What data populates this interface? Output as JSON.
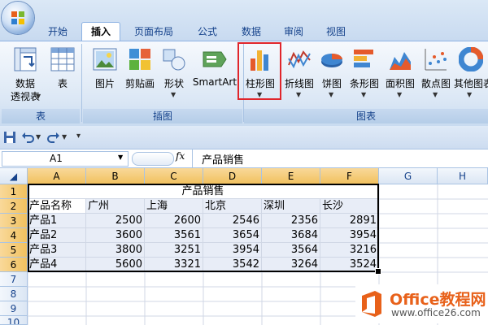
{
  "ribbon": {
    "tabs": [
      {
        "label": "开始"
      },
      {
        "label": "插入"
      },
      {
        "label": "页面布局"
      },
      {
        "label": "公式"
      },
      {
        "label": "数据"
      },
      {
        "label": "审阅"
      },
      {
        "label": "视图"
      }
    ],
    "active_tab": "插入",
    "groups": [
      {
        "label": "表",
        "buttons": [
          {
            "label": "数据透视表"
          },
          {
            "label": "表"
          }
        ]
      },
      {
        "label": "插图",
        "buttons": [
          {
            "label": "图片"
          },
          {
            "label": "剪贴画"
          },
          {
            "label": "形状"
          },
          {
            "label": "SmartArt"
          }
        ]
      },
      {
        "label": "图表",
        "buttons": [
          {
            "label": "柱形图"
          },
          {
            "label": "折线图"
          },
          {
            "label": "饼图"
          },
          {
            "label": "条形图"
          },
          {
            "label": "面积图"
          },
          {
            "label": "散点图"
          },
          {
            "label": "其他图表"
          }
        ]
      }
    ],
    "pivot_line1": "数据",
    "pivot_line2": "透视表",
    "highlight_color": "#e0252b"
  },
  "formula_bar": {
    "name_box": "A1",
    "fx": "fx",
    "content": "产品销售"
  },
  "sheet": {
    "columns": [
      "A",
      "B",
      "C",
      "D",
      "E",
      "F",
      "G",
      "H"
    ],
    "rows": [
      "1",
      "2",
      "3",
      "4",
      "5",
      "6",
      "7",
      "8",
      "9",
      "10"
    ],
    "title": "产品销售",
    "header": [
      "产品名称",
      "广州",
      "上海",
      "北京",
      "深圳",
      "长沙"
    ],
    "data": [
      [
        "产品1",
        "2500",
        "2600",
        "2546",
        "2356",
        "2891"
      ],
      [
        "产品2",
        "3600",
        "3561",
        "3654",
        "3684",
        "3954"
      ],
      [
        "产品3",
        "3800",
        "3251",
        "3954",
        "3564",
        "3216"
      ],
      [
        "产品4",
        "5600",
        "3321",
        "3542",
        "3264",
        "3524"
      ]
    ]
  },
  "watermark": {
    "brand": "Office教程网",
    "url": "www.office26.com",
    "color": "#e8611a"
  }
}
